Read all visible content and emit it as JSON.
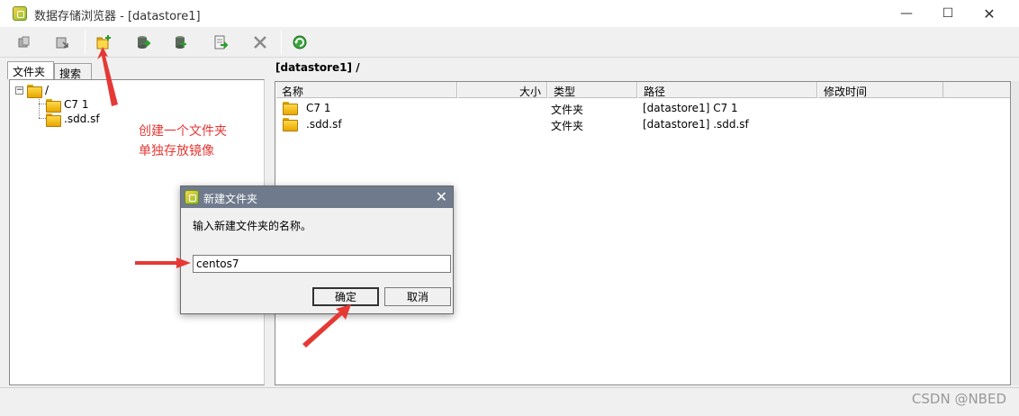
{
  "window": {
    "title": "数据存储浏览器 - [datastore1]",
    "minimize": "—",
    "maximize": "☐",
    "close": "✕"
  },
  "toolbar": {
    "buttons": [
      "upload-icon",
      "download-icon",
      "new-folder-icon",
      "move-icon",
      "copy-icon",
      "export-icon",
      "delete-icon",
      "refresh-icon"
    ]
  },
  "left_panel": {
    "tabs": [
      "文件夹",
      "搜索"
    ],
    "tree": {
      "root": "/",
      "children": [
        "C7 1",
        ".sdd.sf"
      ]
    }
  },
  "right_panel": {
    "path": "[datastore1] /",
    "columns": [
      "名称",
      "大小",
      "类型",
      "路径",
      "修改时间"
    ],
    "rows": [
      {
        "name": "C7 1",
        "size": "",
        "type": "文件夹",
        "path": "[datastore1] C7 1",
        "modified": ""
      },
      {
        "name": ".sdd.sf",
        "size": "",
        "type": "文件夹",
        "path": "[datastore1] .sdd.sf",
        "modified": ""
      }
    ]
  },
  "annotation": {
    "line1": "创建一个文件夹",
    "line2": "单独存放镜像",
    "color": "#e53935"
  },
  "dialog": {
    "title": "新建文件夹",
    "close": "✕",
    "prompt": "输入新建文件夹的名称。",
    "input_value": "centos7",
    "ok_label": "确定",
    "cancel_label": "取消"
  },
  "watermark": "CSDN @NBED"
}
